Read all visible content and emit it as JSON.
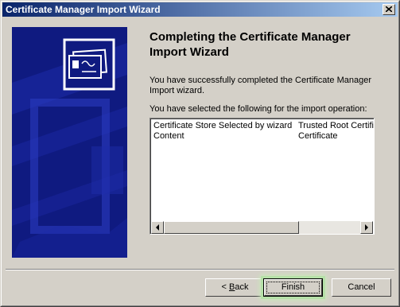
{
  "window": {
    "title": "Certificate Manager Import Wizard"
  },
  "heading": "Completing the Certificate Manager Import Wizard",
  "description": "You have successfully completed the Certificate Manager Import wizard.",
  "selection_label": "You have selected the following for the import operation:",
  "summary_rows": [
    {
      "name": "Certificate Store Selected by wizard",
      "value": "Trusted Root Certifica"
    },
    {
      "name": "Content",
      "value": "Certificate"
    }
  ],
  "buttons": {
    "back_prefix": "< ",
    "back_accel": "B",
    "back_rest": "ack",
    "finish": "Finish",
    "cancel": "Cancel"
  },
  "icons": {
    "close": "close-x-icon",
    "banner": "certificate-icon",
    "scroll_left": "scroll-left-arrow-icon",
    "scroll_right": "scroll-right-arrow-icon"
  },
  "colors": {
    "title_start": "#0a246a",
    "title_end": "#a6caf0",
    "banner_bg": "#0f1a80",
    "face": "#d4d0c8",
    "finish_highlight": "#b5e0a8"
  }
}
